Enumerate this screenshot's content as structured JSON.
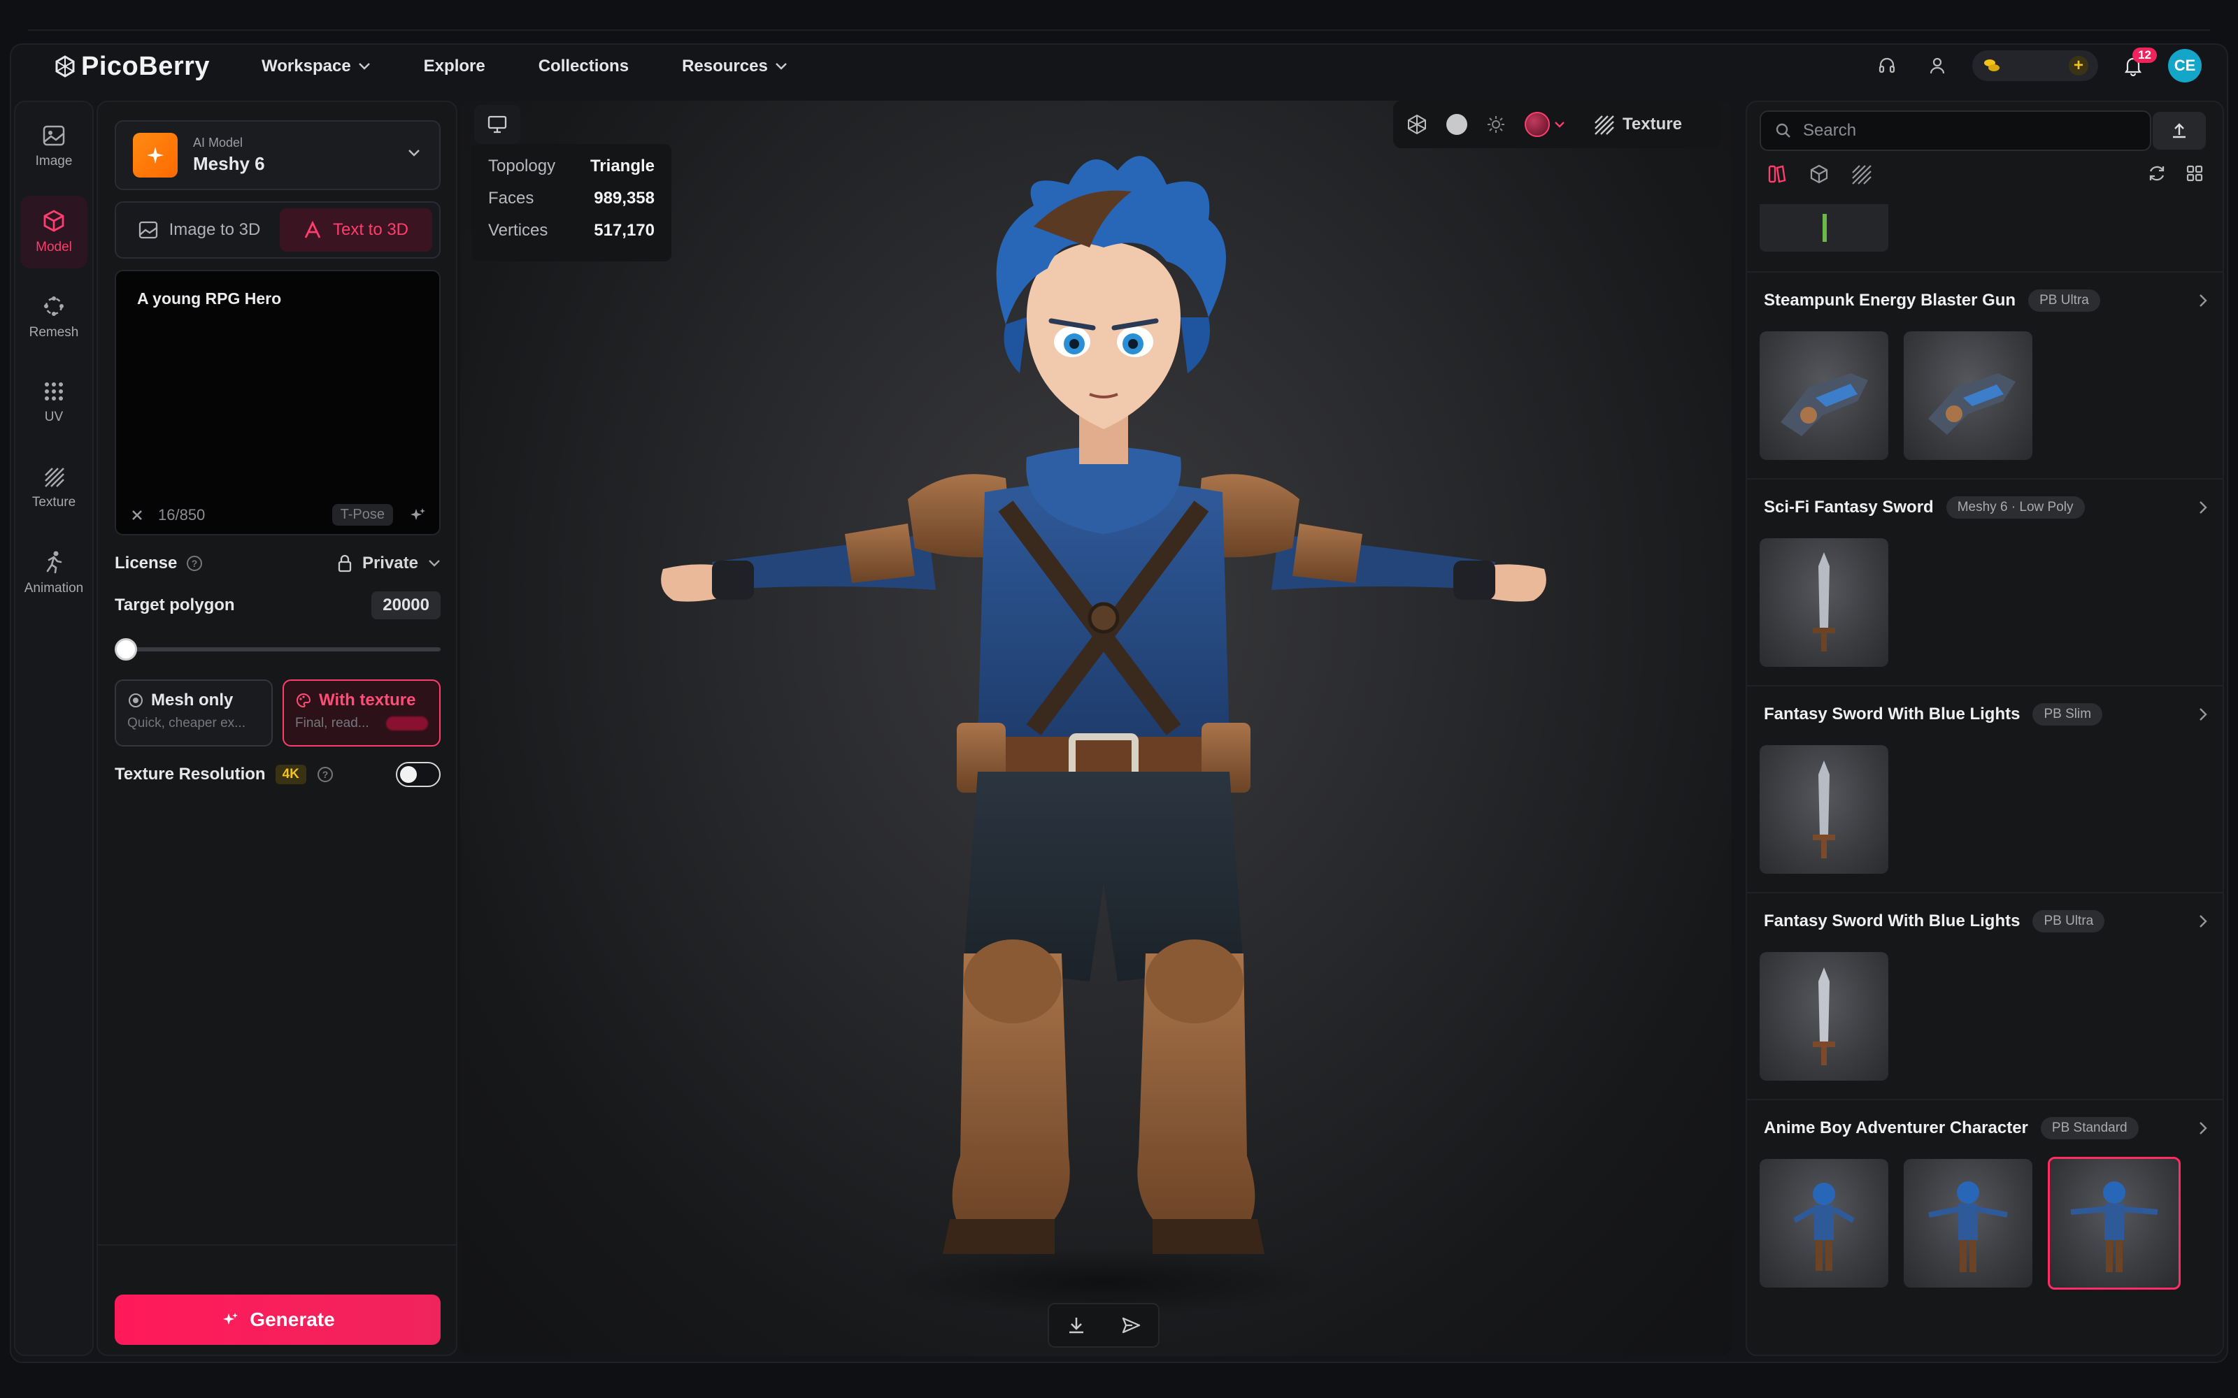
{
  "app": {
    "name": "PicoBerry",
    "nav": [
      "Workspace",
      "Explore",
      "Collections",
      "Resources"
    ],
    "notifications": "12",
    "avatar_initials": "CE"
  },
  "rail": [
    {
      "label": "Image",
      "icon": "image-icon"
    },
    {
      "label": "Model",
      "icon": "cube-icon",
      "active": true
    },
    {
      "label": "Remesh",
      "icon": "remesh-icon"
    },
    {
      "label": "UV",
      "icon": "grid-dots-icon"
    },
    {
      "label": "Texture",
      "icon": "texture-icon"
    },
    {
      "label": "Animation",
      "icon": "running-icon"
    }
  ],
  "panel": {
    "model_caption": "AI Model",
    "model_name": "Meshy 6",
    "mode_image": "Image to 3D",
    "mode_text": "Text to 3D",
    "prompt": "A young RPG Hero",
    "char_count": "16/850",
    "pose_chip": "T-Pose",
    "license_label": "License",
    "license_value": "Private",
    "target_polygon_label": "Target polygon",
    "target_polygon_value": "20000",
    "slider_fraction": 0.0,
    "mesh_only_title": "Mesh only",
    "mesh_only_sub": "Quick, cheaper ex...",
    "with_texture_title": "With texture",
    "with_texture_sub": "Final, read...",
    "texture_resolution_label": "Texture Resolution",
    "texture_resolution_badge": "4K",
    "hd_toggle_on": false,
    "generate_label": "Generate"
  },
  "viewport": {
    "stats": [
      {
        "label": "Topology",
        "value": "Triangle"
      },
      {
        "label": "Faces",
        "value": "989,358"
      },
      {
        "label": "Vertices",
        "value": "517,170"
      }
    ],
    "texture_label": "Texture"
  },
  "right": {
    "search_placeholder": "Search",
    "assets": [
      {
        "title": "Steampunk Energy Blaster Gun",
        "tag": "PB Ultra",
        "thumbs": 2,
        "kind": "gun"
      },
      {
        "title": "Sci-Fi Fantasy Sword",
        "tag": "Meshy 6 · Low Poly",
        "thumbs": 1,
        "kind": "sword"
      },
      {
        "title": "Fantasy Sword With Blue Lights",
        "tag": "PB Slim",
        "thumbs": 1,
        "kind": "sword"
      },
      {
        "title": "Fantasy Sword With Blue Lights",
        "tag": "PB Ultra",
        "thumbs": 1,
        "kind": "sword"
      },
      {
        "title": "Anime Boy Adventurer Character",
        "tag": "PB Standard",
        "thumbs": 3,
        "kind": "hero"
      }
    ]
  },
  "colors": {
    "accent": "#ff2d64",
    "model_logo": "#ff7a0a",
    "avatar": "#14a6c8",
    "badge_4k": "#f3c418"
  }
}
